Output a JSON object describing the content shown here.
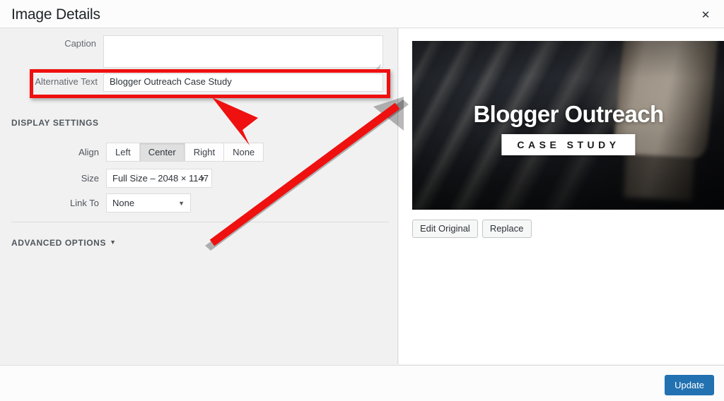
{
  "header": {
    "title": "Image Details",
    "close_icon": "close-icon",
    "close_glyph": "✕"
  },
  "attachment_fields": [
    {
      "label": "Caption",
      "name": "caption",
      "type": "textarea",
      "value": "",
      "placeholder": ""
    },
    {
      "label": "Alternative Text",
      "name": "alt-text",
      "type": "text",
      "value": "Blogger Outreach Case Study",
      "placeholder": ""
    }
  ],
  "display_settings": {
    "heading": "DISPLAY SETTINGS",
    "align": {
      "label": "Align",
      "options": [
        "Left",
        "Center",
        "Right",
        "None"
      ],
      "selected": "Center"
    },
    "size": {
      "label": "Size",
      "value": "Full Size – 2048 × 1147",
      "caret_glyph": "▼"
    },
    "link_to": {
      "label": "Link To",
      "value": "None",
      "caret_glyph": "▼"
    }
  },
  "advanced_options": {
    "heading": "ADVANCED OPTIONS",
    "caret_glyph": "▼",
    "expanded": false
  },
  "preview": {
    "alt": "Blogger Outreach Case Study",
    "overlay_title": "Blogger Outreach",
    "overlay_badge": "CASE STUDY",
    "actions": [
      {
        "label": "Edit Original",
        "name": "edit-original-button"
      },
      {
        "label": "Replace",
        "name": "replace-button"
      }
    ]
  },
  "footer": {
    "update_label": "Update"
  },
  "annotations": {
    "highlight_color": "#ef1010",
    "arrow_color": "#ef1010",
    "highlight_target": "Alternative Text",
    "arrow_points_to": "Alternative Text field"
  },
  "colors": {
    "accent": "#2271b1",
    "panel_bg": "#f1f1f1",
    "header_bg": "#fcfcfc",
    "border": "#dcdcde",
    "annotation": "#ef1010"
  }
}
